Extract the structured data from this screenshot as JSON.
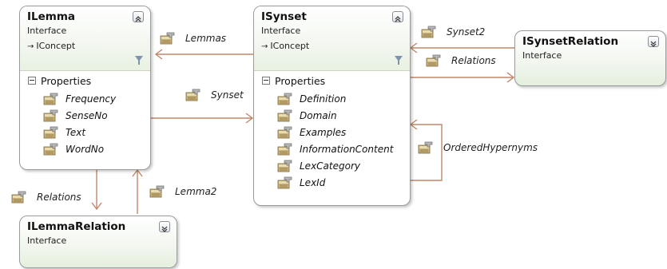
{
  "shapes": {
    "ilemma": {
      "name": "ILemma",
      "stereotype": "Interface",
      "base": "IConcept",
      "compartment": "Properties",
      "properties": [
        "Frequency",
        "SenseNo",
        "Text",
        "WordNo"
      ]
    },
    "isynset": {
      "name": "ISynset",
      "stereotype": "Interface",
      "base": "IConcept",
      "compartment": "Properties",
      "properties": [
        "Definition",
        "Domain",
        "Examples",
        "InformationContent",
        "LexCategory",
        "LexId"
      ]
    },
    "isynsetrelation": {
      "name": "ISynsetRelation",
      "stereotype": "Interface"
    },
    "ilemmarelation": {
      "name": "ILemmaRelation",
      "stereotype": "Interface"
    }
  },
  "associations": {
    "lemmas": "Lemmas",
    "synset": "Synset",
    "synset2": "Synset2",
    "synset_relations": "Relations",
    "ordered_hypernyms": "OrderedHypernyms",
    "lemma_relations": "Relations",
    "lemma2": "Lemma2"
  },
  "colors": {
    "connector": "#c0876a",
    "shape_fill": "#e6f0e0",
    "border": "#9a9a9a"
  }
}
